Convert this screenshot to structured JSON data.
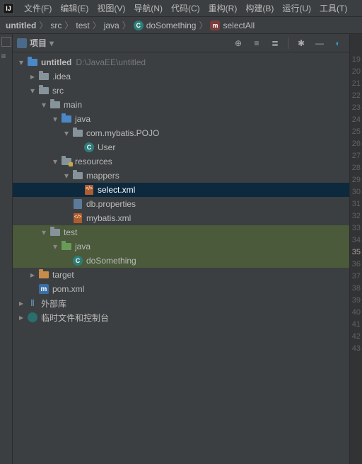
{
  "menu": {
    "items": [
      "文件(F)",
      "编辑(E)",
      "视图(V)",
      "导航(N)",
      "代码(C)",
      "重构(R)",
      "构建(B)",
      "运行(U)",
      "工具(T)"
    ]
  },
  "breadcrumb": {
    "root": "untitled",
    "parts": [
      "src",
      "test",
      "java"
    ],
    "class": "doSomething",
    "method": "selectAll"
  },
  "panel": {
    "title": "项目"
  },
  "tree": {
    "root": {
      "label": "untitled",
      "path": "D:\\JavaEE\\untitled"
    },
    "idea": ".idea",
    "src": "src",
    "main": "main",
    "java_main": "java",
    "pkg": "com.mybatis.POJO",
    "user": "User",
    "resources": "resources",
    "mappers": "mappers",
    "select_xml": "select.xml",
    "db_prop": "db.properties",
    "mybatis_xml": "mybatis.xml",
    "test": "test",
    "java_test": "java",
    "do_something": "doSomething",
    "target": "target",
    "pom": "pom.xml",
    "ext_libs": "外部库",
    "scratch": "临时文件和控制台"
  },
  "linenumbers": [
    "19",
    "20",
    "21",
    "22",
    "23",
    "24",
    "25",
    "26",
    "27",
    "28",
    "29",
    "30",
    "31",
    "32",
    "33",
    "34",
    "35",
    "36",
    "37",
    "38",
    "39",
    "40",
    "41",
    "42",
    "43"
  ],
  "current_line": "35"
}
